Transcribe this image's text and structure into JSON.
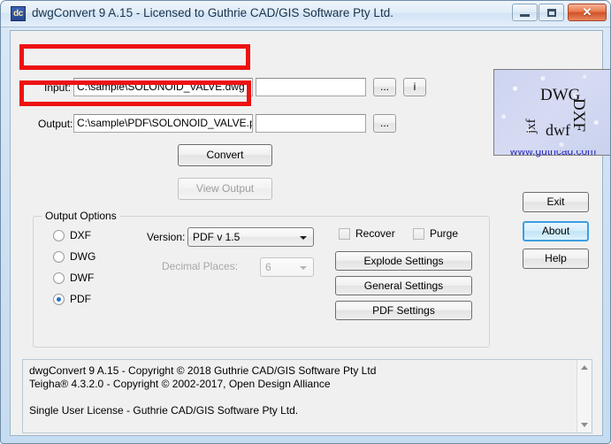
{
  "window": {
    "title": "dwgConvert 9 A.15 - Licensed to Guthrie CAD/GIS Software Pty Ltd.",
    "icon_text": "dc",
    "controls": {
      "minimize": "minimize-button",
      "maximize": "maximize-button",
      "close_glyph": "✕"
    }
  },
  "io": {
    "input_label": "Input:",
    "input_value": "C:\\sample\\SOLONOID_VALVE.dwg",
    "input_second_value": "",
    "output_label": "Output:",
    "output_value": "C:\\sample\\PDF\\SOLONOID_VALVE.pdf",
    "output_second_value": "",
    "browse_label": "...",
    "info_label": "i"
  },
  "actions": {
    "convert": "Convert",
    "view_output": "View Output"
  },
  "output_options": {
    "legend": "Output Options",
    "radios": [
      {
        "label": "DXF",
        "selected": false
      },
      {
        "label": "DWG",
        "selected": false
      },
      {
        "label": "DWF",
        "selected": false
      },
      {
        "label": "PDF",
        "selected": true
      }
    ],
    "version_label": "Version:",
    "version_value": "PDF v 1.5",
    "decimal_places_label": "Decimal Places:",
    "decimal_places_value": "6",
    "checkboxes": [
      {
        "label": "Recover",
        "checked": false
      },
      {
        "label": "Purge",
        "checked": false
      }
    ],
    "buttons": [
      "Explode Settings",
      "General Settings",
      "PDF Settings"
    ]
  },
  "side_buttons": {
    "exit": "Exit",
    "about": "About",
    "help": "Help"
  },
  "logo": {
    "word_dwg": "DWG",
    "word_dxf": "DXF",
    "word_dwf": "dwf",
    "word_jxf": "jxf",
    "url": "www.guthcad.com"
  },
  "log": {
    "text": "dwgConvert 9 A.15 - Copyright © 2018 Guthrie CAD/GIS Software Pty Ltd\nTeigha® 4.3.2.0 - Copyright © 2002-2017, Open Design Alliance\n\nSingle User License - Guthrie CAD/GIS Software Pty Ltd."
  },
  "colors": {
    "annotation": "#ee1111",
    "accent": "#3c9fe0",
    "logo_bg": "#ccd3ee"
  }
}
